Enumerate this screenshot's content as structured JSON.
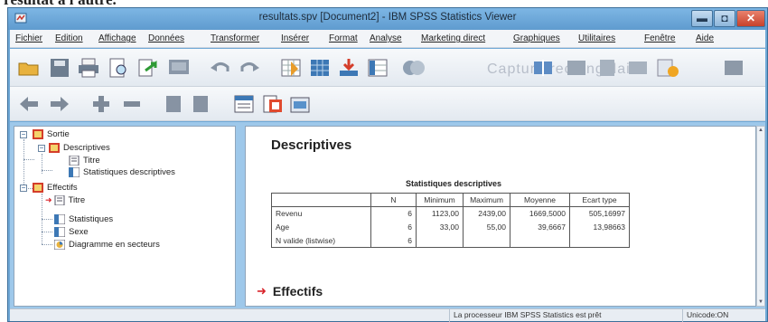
{
  "page_top_text": "résultat à l'autre.",
  "window": {
    "title": "resultats.spv [Document2] - IBM SPSS Statistics Viewer"
  },
  "menu": [
    "Fichier",
    "Edition",
    "Affichage",
    "Données",
    "Transformer",
    "Insérer",
    "Format",
    "Analyse",
    "Marketing direct",
    "Graphiques",
    "Utilitaires",
    "Fenêtre",
    "Aide"
  ],
  "toolbar": {
    "watermark": "Capture rectangulaire"
  },
  "outline": {
    "root": "Sortie",
    "descriptives": "Descriptives",
    "titre1": "Titre",
    "stats_desc": "Statistiques descriptives",
    "effectifs": "Effectifs",
    "titre2": "Titre",
    "statistiques": "Statistiques",
    "sexe": "Sexe",
    "diagramme": "Diagramme en secteurs"
  },
  "viewer": {
    "heading": "Descriptives",
    "table_title": "Statistiques descriptives",
    "columns": [
      "",
      "N",
      "Minimum",
      "Maximum",
      "Moyenne",
      "Ecart type"
    ],
    "rows": [
      [
        "Revenu",
        "6",
        "1123,00",
        "2439,00",
        "1669,5000",
        "505,16997"
      ],
      [
        "Age",
        "6",
        "33,00",
        "55,00",
        "39,6667",
        "13,98663"
      ],
      [
        "N valide (listwise)",
        "6",
        "",
        "",
        "",
        ""
      ]
    ],
    "next_heading": "Effectifs"
  },
  "status": {
    "processor": "La processeur IBM SPSS Statistics est prêt",
    "encoding": "Unicode:ON"
  },
  "colors": {
    "title_blue": "#6fa8d6",
    "pane_blue": "#9ec8ea",
    "arrow_red": "#d8232a"
  }
}
